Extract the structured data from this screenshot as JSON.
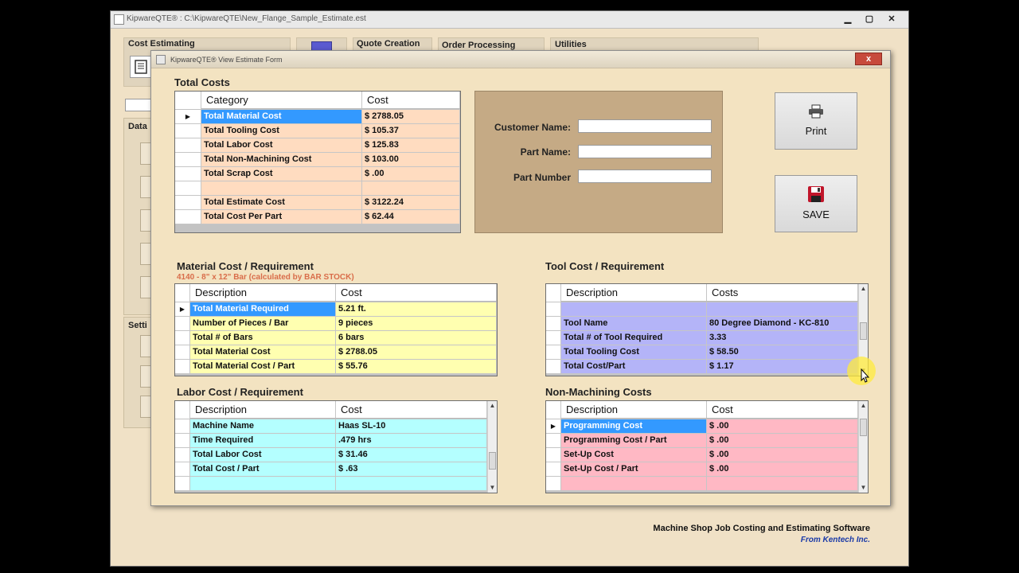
{
  "main_window": {
    "title": "KipwareQTE® : C:\\KipwareQTE\\New_Flange_Sample_Estimate.est",
    "ribbon": {
      "cost_estimating": "Cost Estimating",
      "quote_creation": "Quote Creation",
      "order_processing": "Order Processing",
      "utilities": "Utilities"
    },
    "side_panels": {
      "data": "Data",
      "settings": "Setti"
    },
    "footer_title": "Machine Shop Job Costing and Estimating Software",
    "footer_sub": "From Kentech Inc."
  },
  "dialog": {
    "title": "KipwareQTE® View Estimate Form",
    "close_label": "x"
  },
  "total_costs": {
    "title": "Total Costs",
    "headers": {
      "category": "Category",
      "cost": "Cost"
    },
    "rows": [
      {
        "category": "Total Material Cost",
        "cost": "$ 2788.05"
      },
      {
        "category": "Total Tooling Cost",
        "cost": "$ 105.37"
      },
      {
        "category": "Total Labor Cost",
        "cost": "$ 125.83"
      },
      {
        "category": "Total Non-Machining Cost",
        "cost": "$ 103.00"
      },
      {
        "category": "Total Scrap Cost",
        "cost": "$ .00"
      },
      {
        "category": "",
        "cost": ""
      },
      {
        "category": "Total Estimate Cost",
        "cost": "$ 3122.24"
      },
      {
        "category": "Total Cost Per Part",
        "cost": "$ 62.44"
      }
    ]
  },
  "customer": {
    "customer_name_label": "Customer Name:",
    "customer_name_value": "",
    "part_name_label": "Part Name:",
    "part_name_value": "",
    "part_number_label": "Part Number",
    "part_number_value": ""
  },
  "buttons": {
    "print_label": "Print",
    "save_label": "SAVE"
  },
  "material": {
    "title": "Material Cost / Requirement",
    "note": "4140 - 8\" x 12\" Bar (calculated by BAR STOCK)",
    "headers": {
      "description": "Description",
      "cost": "Cost"
    },
    "rows": [
      {
        "description": "Total Material Required",
        "cost": "5.21 ft."
      },
      {
        "description": "Number of Pieces / Bar",
        "cost": "9 pieces"
      },
      {
        "description": "Total # of Bars",
        "cost": "6 bars"
      },
      {
        "description": "Total Material Cost",
        "cost": "$ 2788.05"
      },
      {
        "description": "Total Material Cost / Part",
        "cost": "$ 55.76"
      }
    ]
  },
  "tool": {
    "title": "Tool Cost / Requirement",
    "headers": {
      "description": "Description",
      "cost": "Costs"
    },
    "rows": [
      {
        "description": "",
        "cost": ""
      },
      {
        "description": "Tool Name",
        "cost": "80 Degree Diamond - KC-810"
      },
      {
        "description": "Total # of Tool Required",
        "cost": "3.33"
      },
      {
        "description": "Total Tooling Cost",
        "cost": "$ 58.50"
      },
      {
        "description": "Total Cost/Part",
        "cost": "$ 1.17"
      }
    ]
  },
  "labor": {
    "title": "Labor Cost / Requirement",
    "headers": {
      "description": "Description",
      "cost": "Cost"
    },
    "rows": [
      {
        "description": "Machine Name",
        "cost": "Haas SL-10"
      },
      {
        "description": "Time Required",
        "cost": ".479 hrs"
      },
      {
        "description": "Total Labor Cost",
        "cost": "$ 31.46"
      },
      {
        "description": "Total Cost / Part",
        "cost": "$ .63"
      },
      {
        "description": "",
        "cost": ""
      }
    ]
  },
  "non_machining": {
    "title": "Non-Machining Costs",
    "headers": {
      "description": "Description",
      "cost": "Cost"
    },
    "rows": [
      {
        "description": "Programming Cost",
        "cost": "$ .00"
      },
      {
        "description": "Programming Cost / Part",
        "cost": "$ .00"
      },
      {
        "description": "Set-Up Cost",
        "cost": "$ .00"
      },
      {
        "description": "Set-Up Cost / Part",
        "cost": "$ .00"
      },
      {
        "description": "",
        "cost": ""
      }
    ]
  },
  "colors": {
    "total_costs_rows": "#ffdcc0",
    "material_rows": "#ffffb0",
    "tool_rows": "#b4b4f8",
    "labor_rows": "#b4ffff",
    "non_machining_rows": "#ffb8c4",
    "selection": "#3399ff"
  },
  "icons": {
    "print": "printer-icon",
    "save": "floppy-disk-icon"
  }
}
